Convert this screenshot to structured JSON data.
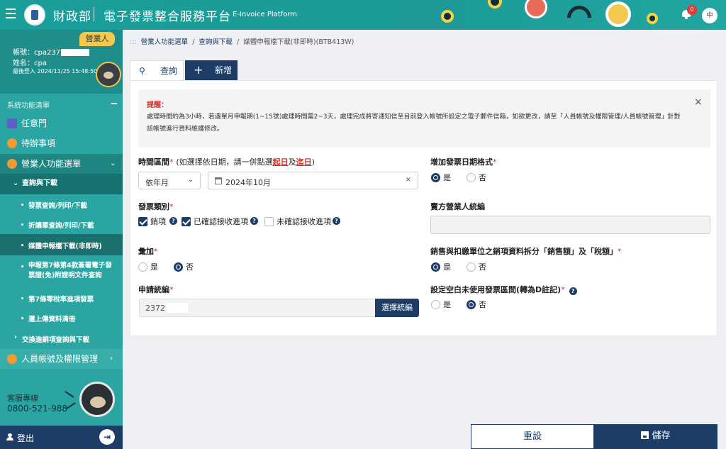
{
  "header": {
    "ministry": "財政部",
    "platform": "電子發票整合服務平台",
    "platform_en": "E-Invoice Platform",
    "notification_count": "0",
    "lang": "中"
  },
  "user": {
    "role": "營業人",
    "account": "帳號：cpa237",
    "name": "姓名：cpa",
    "last_login": "最後登入 2024/11/25 15:48:50"
  },
  "sidebar": {
    "section_title": "系統功能清單",
    "items": [
      {
        "label": "任意門"
      },
      {
        "label": "待辦事項"
      },
      {
        "label": "營業人功能選單"
      },
      {
        "label": "查詢與下載"
      },
      {
        "label": "發票查詢/列印/下載"
      },
      {
        "label": "折讓單查詢/列印/下載"
      },
      {
        "label": "媒體申報檔下載(非即時)"
      },
      {
        "label_line1": "申報第7條第4款簽署電子發",
        "label_line2": "票證(免)附證明文件查詢"
      },
      {
        "label": "第7條零稅率進項發票"
      },
      {
        "label": "還上傳資料清冊"
      },
      {
        "label": "交換進銷項查詢與下載"
      },
      {
        "label": "人員帳號及權限管理"
      }
    ],
    "support_label": "客服專線",
    "support_phone": "0800-521-988",
    "logout": "登出"
  },
  "breadcrumb": {
    "root": "營業人功能選單",
    "sep": "/",
    "parent": "查詢與下載",
    "current": "媒體申報檔下載(非即時)(BTB413W)"
  },
  "tabs": {
    "query": "查詢",
    "add": "新增"
  },
  "notice": {
    "title": "提醒：",
    "text": "處理時間約為3小時，若遇單月申報期(1~15號)處理時間需2~3天，處理完成將寄通知信至目前登入帳號所設定之電子郵件信箱，如欲更改，請至「人員帳號及權限管理/人員帳號管理」針對該帳號進行資料維護修改。",
    "close": "×"
  },
  "form": {
    "period_label": "時間區間",
    "required_mark": "*",
    "period_hint_pre": "(如選擇依日期，請一併點選",
    "period_hint_start": "起日",
    "period_hint_mid": "及",
    "period_hint_end": "迄日",
    "period_hint_post": ")",
    "period_mode": "依年月",
    "period_value": "2024年10月",
    "add_date_label": "增加發票日期格式",
    "yes": "是",
    "no": "否",
    "category_label": "發票類別",
    "cat_sales": "銷項",
    "cat_confirmed": "已確認接收進項",
    "cat_unconfirmed": "未確認接收進項",
    "seller_id_label": "賣方營業人統編",
    "seller_id_value": "",
    "aggregate_label": "彙加",
    "split_label": "銷售與扣繳單位之銷項資料拆分「銷售額」及「稅額」",
    "applicant_label": "申請統編",
    "applicant_value": "2372",
    "choose_btn": "選擇統編",
    "blank_label": "設定空白未使用發票區間(轉為D註記)"
  },
  "footer": {
    "reset": "重設",
    "save": "儲存"
  },
  "colors": {
    "teal": "#2ba5a2",
    "navy": "#1e3d66",
    "alert_red": "#d4322c"
  }
}
